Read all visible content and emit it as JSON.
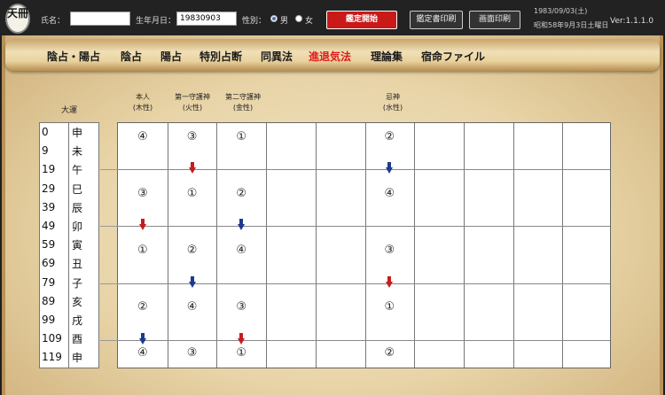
{
  "header": {
    "logo_text": "天冊",
    "name_label": "氏名：",
    "name_value": "",
    "birth_label": "生年月日：",
    "birth_value": "19830903",
    "gender_label": "性別：",
    "gender_male": "男",
    "gender_female": "女",
    "gender_selected": "male",
    "start_button": "鑑定開始",
    "print_cert_button": "鑑定書印刷",
    "print_screen_button": "画面印刷",
    "date_western": "1983/09/03(土)",
    "date_japanese": "昭和58年9月3日土曜日",
    "version": "Ver:1.1.1.0"
  },
  "tabs": [
    {
      "label": "陰占・陽占"
    },
    {
      "label": "陰占"
    },
    {
      "label": "陽占"
    },
    {
      "label": "特別占断"
    },
    {
      "label": "同異法"
    },
    {
      "label": "進退気法",
      "active": true
    },
    {
      "label": "理論集"
    },
    {
      "label": "宿命ファイル"
    }
  ],
  "taiun": {
    "label": "大運",
    "rows": [
      {
        "age": "0",
        "kanji": "申"
      },
      {
        "age": "9",
        "kanji": "未"
      },
      {
        "age": "19",
        "kanji": "午"
      },
      {
        "age": "29",
        "kanji": "巳"
      },
      {
        "age": "39",
        "kanji": "辰"
      },
      {
        "age": "49",
        "kanji": "卯"
      },
      {
        "age": "59",
        "kanji": "寅"
      },
      {
        "age": "69",
        "kanji": "丑"
      },
      {
        "age": "79",
        "kanji": "子"
      },
      {
        "age": "89",
        "kanji": "亥"
      },
      {
        "age": "99",
        "kanji": "戌"
      },
      {
        "age": "109",
        "kanji": "酉"
      },
      {
        "age": "119",
        "kanji": "申"
      }
    ]
  },
  "columns": [
    {
      "line1": "本人",
      "line2": "(木性)"
    },
    {
      "line1": "第一守護神",
      "line2": "(火性)"
    },
    {
      "line1": "第二守護神",
      "line2": "(金性)"
    },
    {
      "line1": "",
      "line2": ""
    },
    {
      "line1": "",
      "line2": ""
    },
    {
      "line1": "忌神",
      "line2": "(水性)"
    },
    {
      "line1": "",
      "line2": ""
    },
    {
      "line1": "",
      "line2": ""
    },
    {
      "line1": "",
      "line2": ""
    },
    {
      "line1": "",
      "line2": ""
    }
  ],
  "grid": {
    "bands": [
      [
        "④",
        "③",
        "①",
        "",
        "",
        "②",
        "",
        "",
        "",
        ""
      ],
      [
        "③",
        "①",
        "②",
        "",
        "",
        "④",
        "",
        "",
        "",
        ""
      ],
      [
        "①",
        "②",
        "④",
        "",
        "",
        "③",
        "",
        "",
        "",
        ""
      ],
      [
        "②",
        "④",
        "③",
        "",
        "",
        "①",
        "",
        "",
        "",
        ""
      ],
      [
        "④",
        "③",
        "①",
        "",
        "",
        "②",
        "",
        "",
        "",
        ""
      ]
    ],
    "arrows": [
      {
        "col": 1,
        "after_band": 0,
        "color": "red"
      },
      {
        "col": 5,
        "after_band": 0,
        "color": "blue"
      },
      {
        "col": 0,
        "after_band": 1,
        "color": "red"
      },
      {
        "col": 2,
        "after_band": 1,
        "color": "blue"
      },
      {
        "col": 1,
        "after_band": 2,
        "color": "blue"
      },
      {
        "col": 5,
        "after_band": 2,
        "color": "red"
      },
      {
        "col": 0,
        "after_band": 3,
        "color": "blue"
      },
      {
        "col": 2,
        "after_band": 3,
        "color": "red"
      }
    ]
  }
}
